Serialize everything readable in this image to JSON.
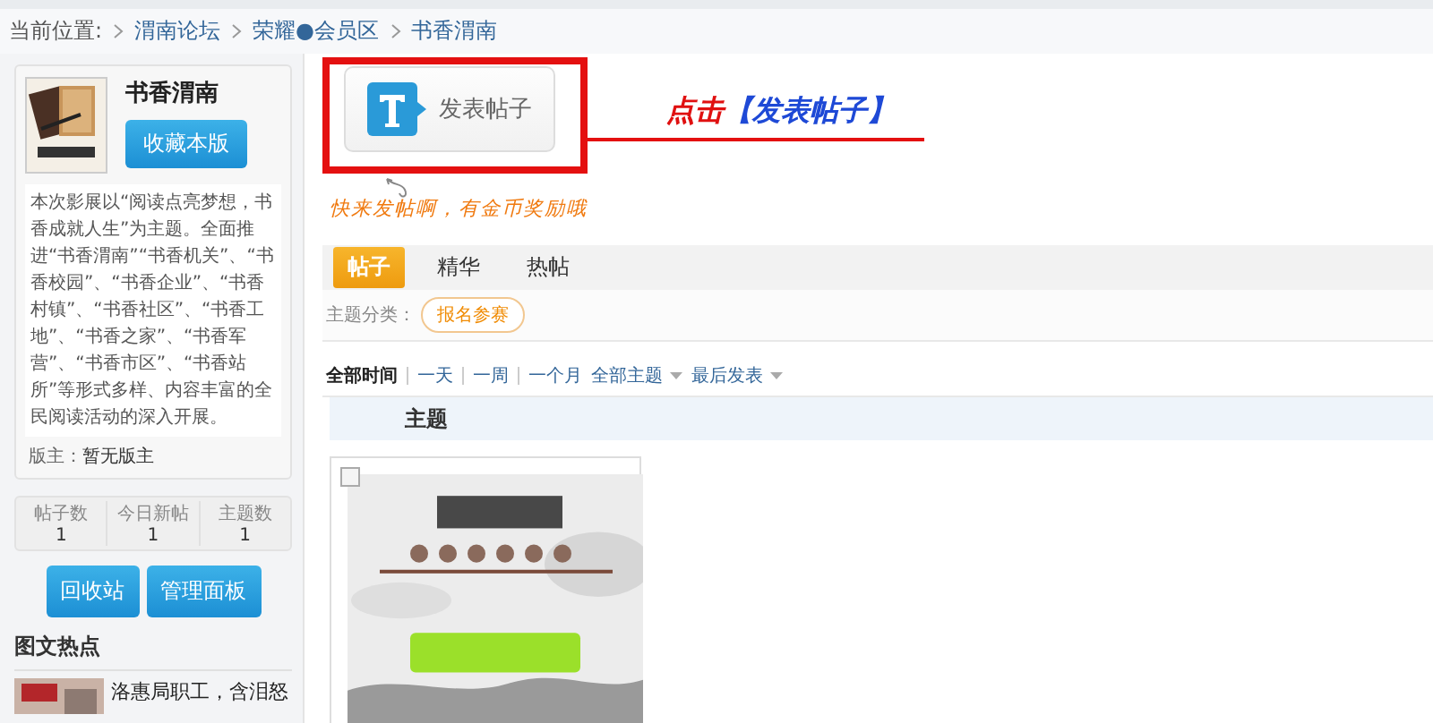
{
  "breadcrumb": {
    "label": "当前位置:",
    "items": [
      {
        "text": "渭南论坛"
      },
      {
        "text": "荣耀●会员区"
      },
      {
        "text": "书香渭南"
      }
    ]
  },
  "forum": {
    "name": "书香渭南",
    "favorite_button": "收藏本版",
    "description": "本次影展以“阅读点亮梦想，书香成就人生”为主题。全面推进“书香渭南”“书香机关”、“书香校园”、“书香企业”、“书香村镇”、“书香社区”、“书香工地”、“书香之家”、“书香军营”、“书香市区”、“书香站所”等形式多样、内容丰富的全民阅读活动的深入开展。",
    "moderator_label": "版主：",
    "moderator": "暂无版主",
    "stats": [
      {
        "label": "帖子数",
        "value": "1"
      },
      {
        "label": "今日新帖",
        "value": "1"
      },
      {
        "label": "主题数",
        "value": "1"
      }
    ],
    "buttons": [
      "回收站",
      "管理面板"
    ],
    "hot_title": "图文热点",
    "hot_items": [
      {
        "title": "洛惠局职工，含泪怒"
      }
    ]
  },
  "post_button": "发表帖子",
  "annotation": {
    "action": "点击",
    "target": "【发表帖子】"
  },
  "hint": "快来发帖啊，有金币奖励哦",
  "tabs": [
    {
      "label": "帖子",
      "selected": true
    },
    {
      "label": "精华",
      "selected": false
    },
    {
      "label": "热帖",
      "selected": false
    }
  ],
  "category": {
    "label": "主题分类：",
    "tags": [
      "报名参赛"
    ]
  },
  "filters": [
    {
      "label": "全部时间",
      "selected": true,
      "kind": "option"
    },
    {
      "label": "一天",
      "selected": false,
      "kind": "option"
    },
    {
      "label": "一周",
      "selected": false,
      "kind": "option"
    },
    {
      "label": "一个月",
      "selected": false,
      "kind": "option"
    },
    {
      "label": "全部主题",
      "selected": false,
      "kind": "dropdown"
    },
    {
      "label": "最后发表",
      "selected": false,
      "kind": "dropdown"
    }
  ],
  "table": {
    "columns": [
      "主题"
    ]
  }
}
